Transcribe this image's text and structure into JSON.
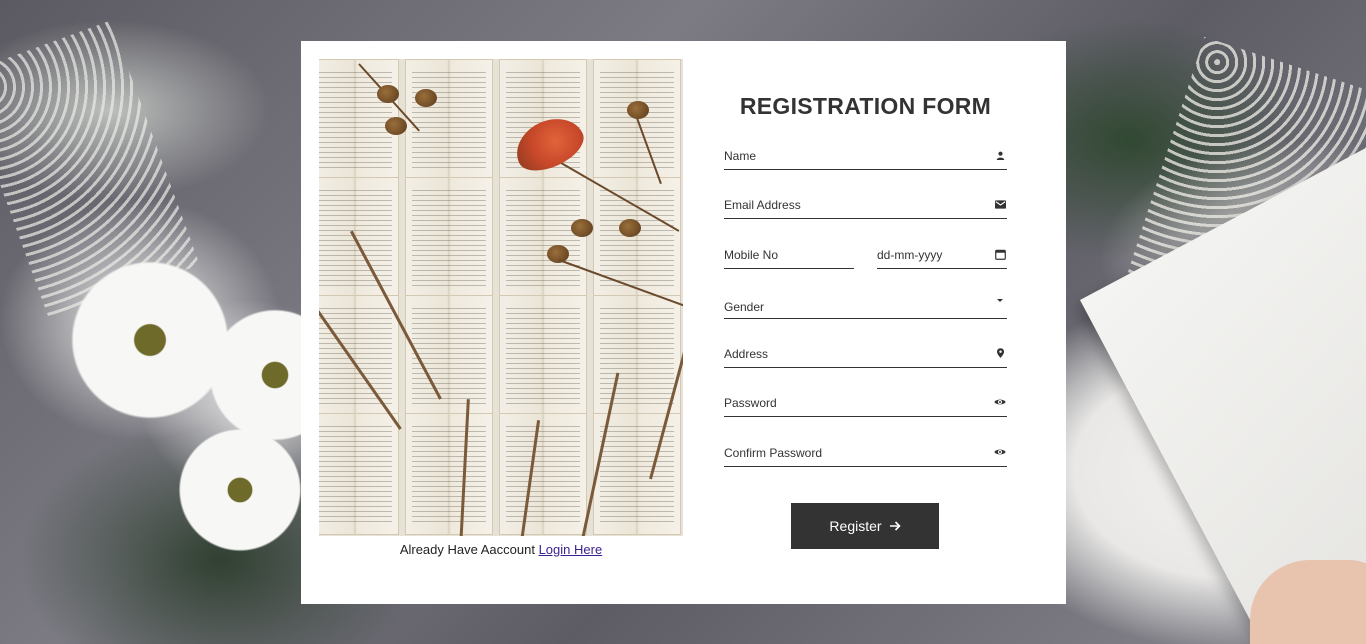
{
  "form": {
    "title": "REGISTRATION FORM",
    "name_placeholder": "Name",
    "email_placeholder": "Email Address",
    "mobile_placeholder": "Mobile No",
    "date_placeholder": "dd-mm-yyyy",
    "gender_value": "Gender",
    "address_placeholder": "Address",
    "password_placeholder": "Password",
    "confirm_password_placeholder": "Confirm Password",
    "register_label": "Register"
  },
  "footer": {
    "already_text": "Already Have Aaccount",
    "login_link": "Login Here"
  },
  "icons": {
    "name": "user-icon",
    "email": "envelope-icon",
    "date": "calendar-icon",
    "gender": "caret-down-icon",
    "address": "map-pin-icon",
    "password": "eye-icon",
    "confirm_password": "eye-icon",
    "register": "arrow-right-icon"
  },
  "colors": {
    "card_bg": "#ffffff",
    "button_bg": "#333333",
    "text": "#333333",
    "link": "#3b1f8f"
  }
}
